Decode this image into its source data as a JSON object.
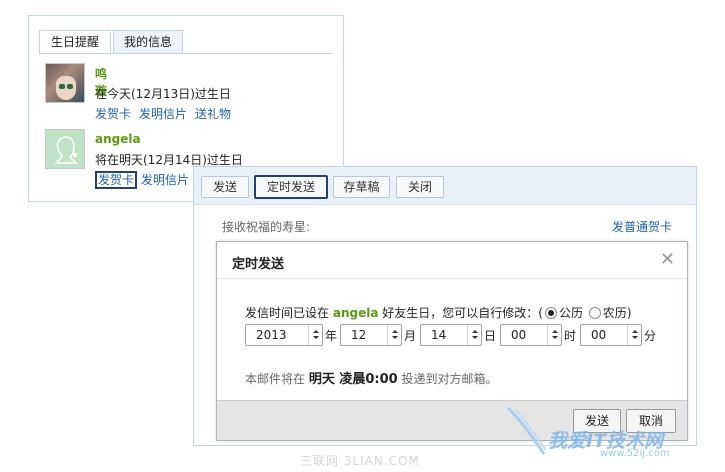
{
  "birthday_panel": {
    "tabs": [
      {
        "label": "生日提醒",
        "active": true
      },
      {
        "label": "我的信息",
        "active": false
      }
    ],
    "entries": [
      {
        "name": "鸣璇",
        "status": "在今天(12月13日)过生日",
        "links": [
          "发贺卡",
          "发明信片",
          "送礼物"
        ]
      },
      {
        "name": "angela",
        "status": "将在明天(12月14日)过生日",
        "links": [
          "发贺卡",
          "发明信片"
        ]
      }
    ]
  },
  "compose": {
    "toolbar": [
      "发送",
      "定时发送",
      "存草稿",
      "关闭"
    ],
    "recipient_label": "接收祝福的寿星:",
    "normal_card_link": "发普通贺卡"
  },
  "dialog": {
    "title": "定时发送",
    "close_icon": "close-icon",
    "text_prefix": "发信时间已设在",
    "text_name": "angela",
    "text_suffix": "好友生日，您可以自行修改：(",
    "calendar_solar": "公历",
    "calendar_lunar": "农历",
    "calendar_close": ")",
    "selected_calendar": "公历",
    "year": "2013",
    "year_unit": "年",
    "month": "12",
    "month_unit": "月",
    "day": "14",
    "day_unit": "日",
    "hour": "00",
    "hour_unit": "时",
    "minute": "00",
    "minute_unit": "分",
    "notice_prefix": "本邮件将在",
    "notice_when": "明天 凌晨0:00",
    "notice_suffix": "投递到对方邮箱。",
    "send_label": "发送",
    "cancel_label": "取消"
  },
  "watermarks": {
    "bottom": "三联网 3LIAN.COM",
    "logo_text": "我爱IT技术网",
    "logo_url": "www.52ij.com"
  },
  "colors": {
    "accent_link": "#1f5fa8",
    "name_green": "#5c9a12",
    "highlight_border": "#24426b"
  }
}
